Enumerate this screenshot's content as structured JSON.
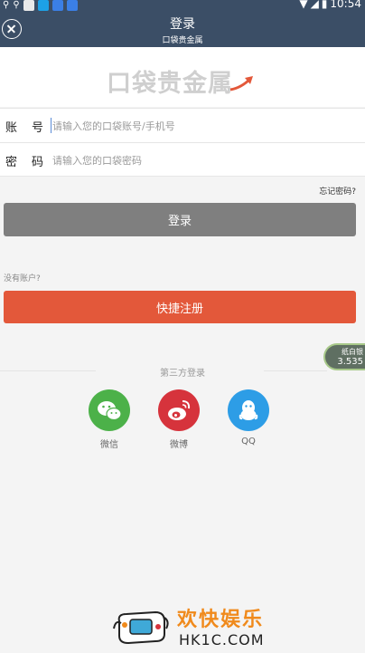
{
  "status_bar": {
    "time": "10:54",
    "app_icons": [
      "search-icon",
      "maps-icon",
      "zhifubao-icon",
      "baidu-icon",
      "baidu-icon"
    ],
    "system_icons": [
      "wifi-icon",
      "signal-icon",
      "battery-icon"
    ]
  },
  "header": {
    "title": "登录",
    "subtitle": "口袋贵金属"
  },
  "logo": {
    "text": "口袋贵金属",
    "accent_color": "#e3583a"
  },
  "form": {
    "account": {
      "label": "账号",
      "placeholder": "请输入您的口袋账号/手机号",
      "value": ""
    },
    "password": {
      "label": "密码",
      "placeholder": "请输入您的口袋密码",
      "value": ""
    },
    "forgot_password": "忘记密码?"
  },
  "login_button": {
    "label": "登录",
    "color": "#7f7f7f"
  },
  "register": {
    "prompt": "没有账户?",
    "button_label": "快捷注册",
    "color": "#e3583a"
  },
  "ticker": {
    "name": "纸白银",
    "value": "3.535"
  },
  "third_party": {
    "title": "第三方登录",
    "options": [
      {
        "label": "微信",
        "icon": "wechat-icon",
        "color": "#4cb149"
      },
      {
        "label": "微博",
        "icon": "weibo-icon",
        "color": "#d6333c"
      },
      {
        "label": "QQ",
        "icon": "qq-icon",
        "color": "#2d9de6"
      }
    ]
  },
  "watermark": {
    "text": "欢快娱乐",
    "domain": "HK1C.COM"
  }
}
